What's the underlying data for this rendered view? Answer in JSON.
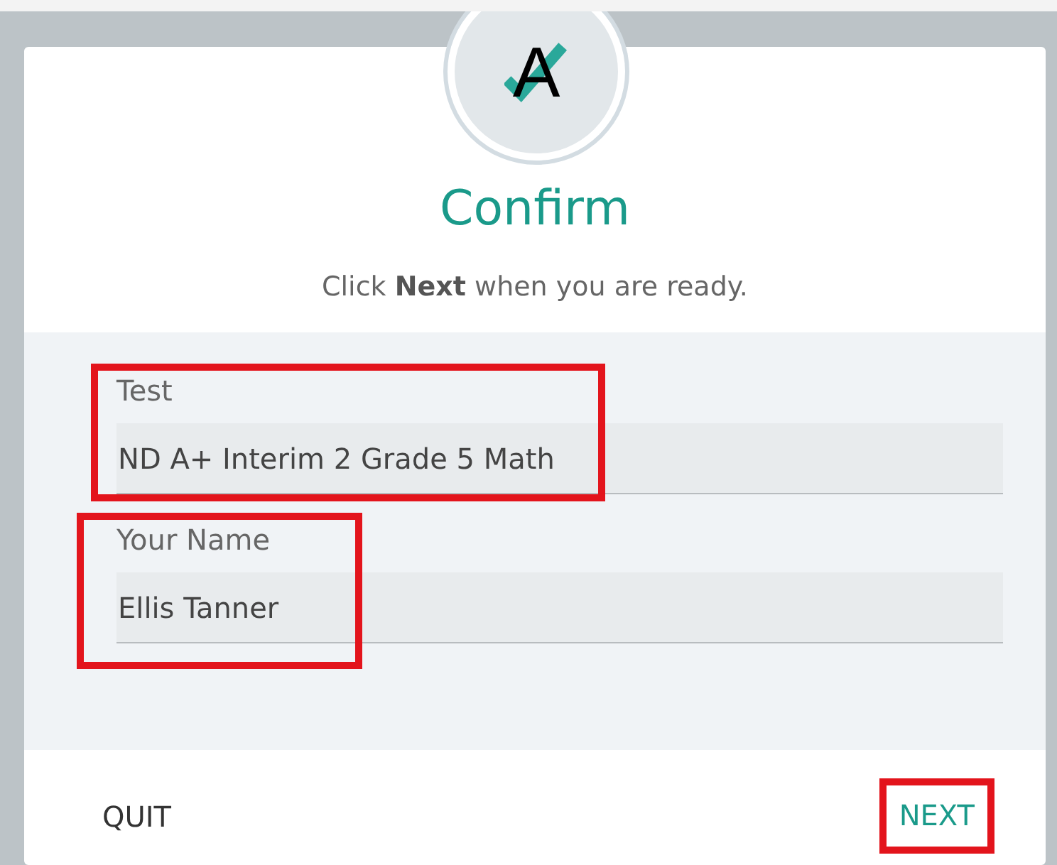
{
  "logo": {
    "letter": "A"
  },
  "title": "Confirm",
  "subtitle": "Click **Next** when you are ready.",
  "fields": [
    {
      "label": "Test",
      "value": "ND A+ Interim 2 Grade 5 Math",
      "highlighted": true
    },
    {
      "label": "Your Name",
      "value": "Ellis Tanner",
      "highlighted": true
    }
  ],
  "buttons": [
    {
      "kind": "quit",
      "label": "QUIT",
      "highlighted": false
    },
    {
      "kind": "next",
      "label": "NEXT",
      "highlighted": true
    }
  ]
}
